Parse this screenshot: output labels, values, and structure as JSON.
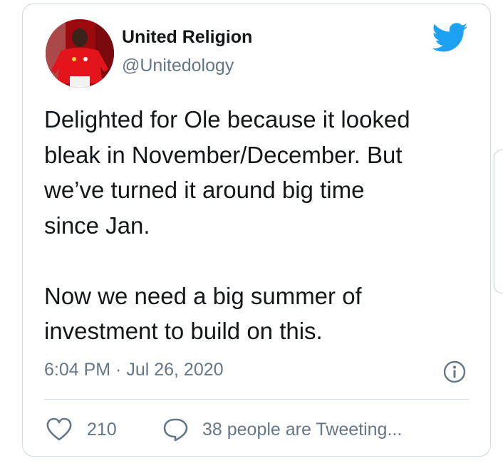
{
  "tweet": {
    "display_name": "United Religion",
    "handle": "@Unitedology",
    "text_paragraphs": [
      [
        "Delighted for Ole because it looked",
        "bleak in November/December. But",
        "we’ve turned it around big time",
        "since Jan."
      ],
      [
        "Now we need a big summer of",
        "investment to build on this."
      ]
    ],
    "timestamp": "6:04 PM · Jul 26, 2020",
    "like_count": "210",
    "reply_label": "38 people are Tweeting..."
  },
  "icons": {
    "brand": "twitter-bird-icon",
    "info": "info-icon",
    "like": "heart-icon",
    "reply": "speech-bubble-icon"
  },
  "colors": {
    "brand_blue": "#1da1f2",
    "text_primary": "#14171a",
    "text_secondary": "#657786",
    "border": "#cfd9de"
  }
}
